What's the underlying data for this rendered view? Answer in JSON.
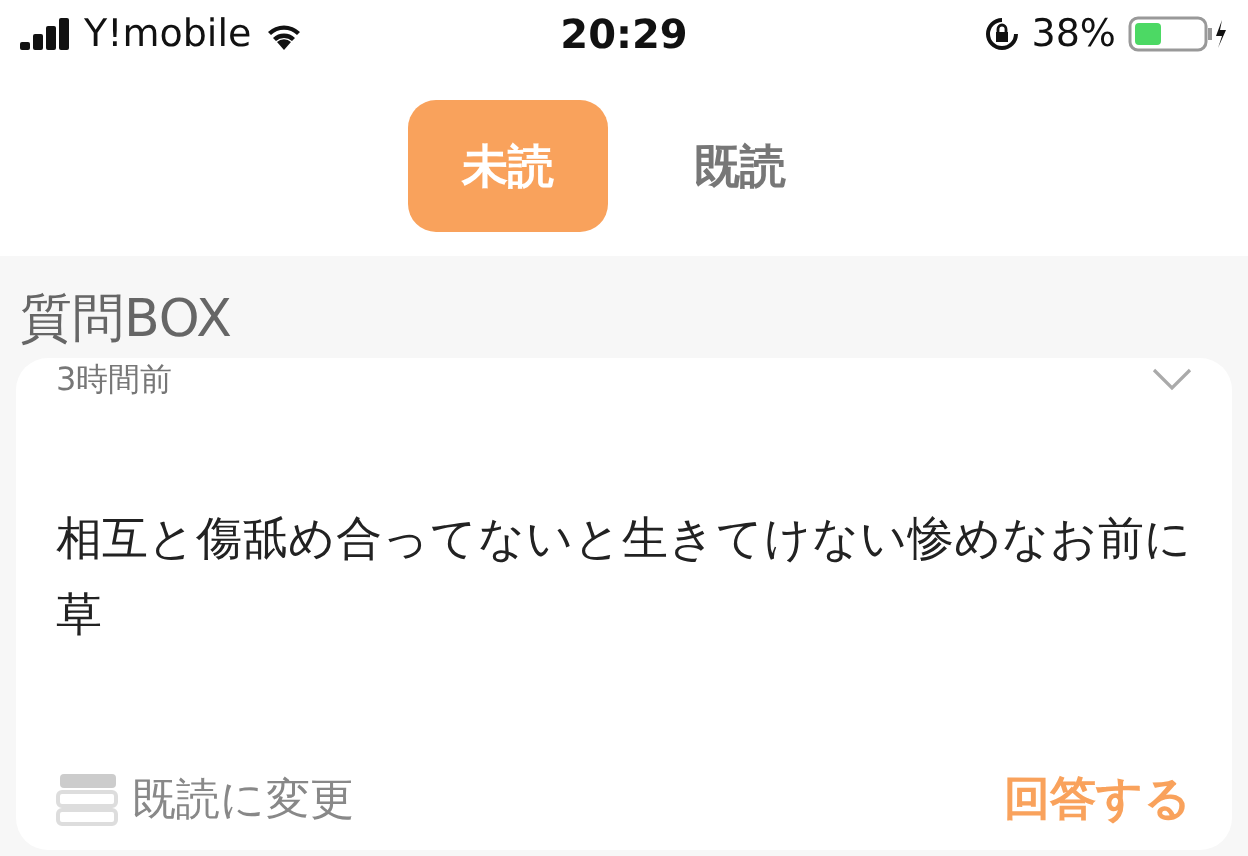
{
  "status_bar": {
    "carrier": "Y!mobile",
    "time": "20:29",
    "battery": "38%"
  },
  "tabs": [
    {
      "label": "未読",
      "selected": true
    },
    {
      "label": "既読",
      "selected": false
    }
  ],
  "section_title": "質問BOX",
  "card": {
    "time": "3時間前",
    "expanded": false,
    "message": "相互と傷舐め合ってないと生きてけない惨めなお前に草",
    "mark_read": "既読に変更",
    "answer": "回答する"
  }
}
